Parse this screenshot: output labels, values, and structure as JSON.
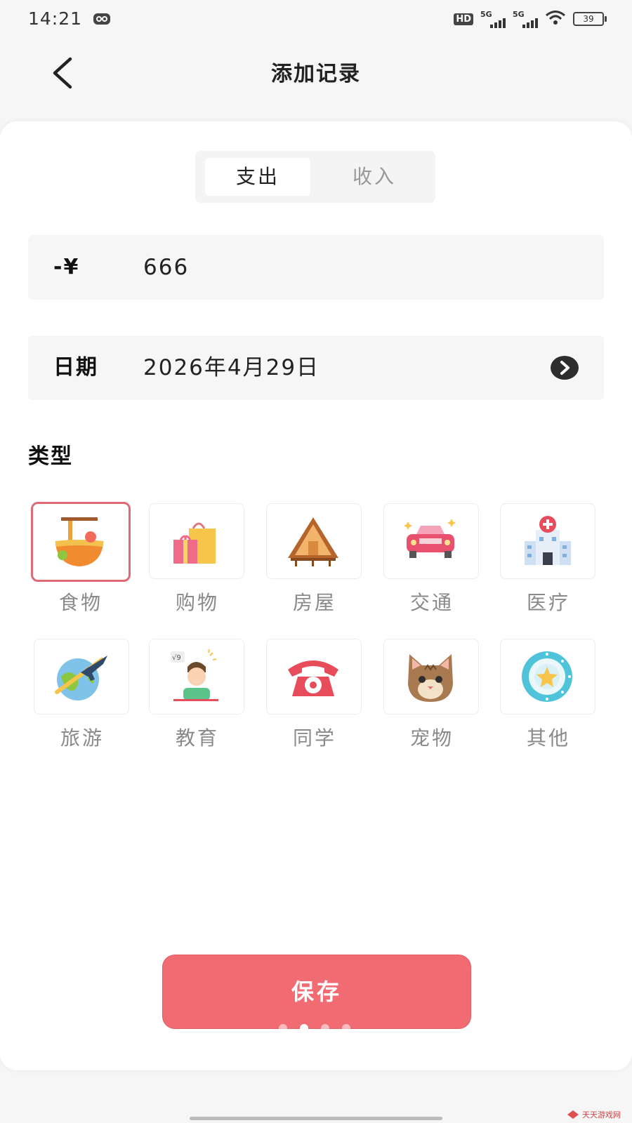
{
  "status_bar": {
    "time": "14:21",
    "hd_label": "HD",
    "sim1": "5G",
    "sim2": "5G",
    "battery": "39"
  },
  "nav": {
    "title": "添加记录",
    "back_icon": "chevron-left-icon"
  },
  "segment": {
    "expense": "支出",
    "income": "收入",
    "selected": "支出"
  },
  "amount": {
    "prefix": "-¥",
    "value": "666"
  },
  "date": {
    "label": "日期",
    "value": "2026年4月29日",
    "icon": "chevron-right-circle-icon"
  },
  "category_section": {
    "title": "类型",
    "selected": "食物",
    "items": [
      {
        "label": "食物",
        "icon": "noodle-bowl-icon"
      },
      {
        "label": "购物",
        "icon": "shopping-bag-icon"
      },
      {
        "label": "房屋",
        "icon": "house-icon"
      },
      {
        "label": "交通",
        "icon": "car-icon"
      },
      {
        "label": "医疗",
        "icon": "hospital-icon"
      },
      {
        "label": "旅游",
        "icon": "airplane-globe-icon"
      },
      {
        "label": "教育",
        "icon": "student-icon"
      },
      {
        "label": "同学",
        "icon": "telephone-icon"
      },
      {
        "label": "宠物",
        "icon": "cat-icon"
      },
      {
        "label": "其他",
        "icon": "star-badge-icon"
      }
    ]
  },
  "save_button": {
    "label": "保存"
  },
  "colors": {
    "accent": "#f06b72",
    "selected_border": "#e06a73"
  },
  "watermark": "天天游戏网"
}
